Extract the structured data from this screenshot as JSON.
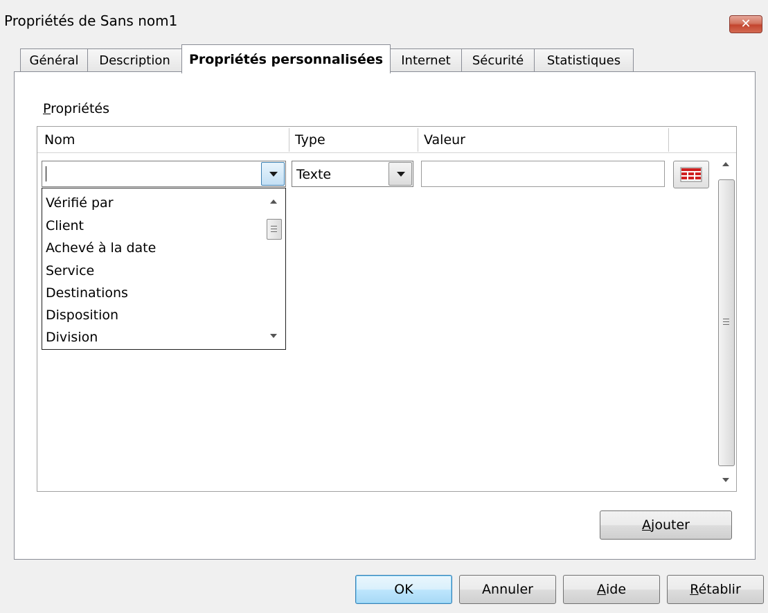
{
  "window": {
    "title": "Propriétés de Sans nom1",
    "close_label": "✕"
  },
  "tabs": [
    {
      "label": "Général"
    },
    {
      "label": "Description"
    },
    {
      "label": "Propriétés personnalisées",
      "active": true
    },
    {
      "label": "Internet"
    },
    {
      "label": "Sécurité"
    },
    {
      "label": "Statistiques"
    }
  ],
  "properties": {
    "label_accel": "P",
    "label_rest": "ropriétés",
    "columns": {
      "name": "Nom",
      "type": "Type",
      "value": "Valeur"
    },
    "row": {
      "name_value": "",
      "type_value": "Texte",
      "value_value": ""
    },
    "name_dropdown": {
      "items": [
        "Vérifié par",
        "Client",
        "Achevé à la date",
        "Service",
        "Destinations",
        "Disposition",
        "Division"
      ]
    }
  },
  "add_button": {
    "accel": "A",
    "rest": "jouter"
  },
  "footer": {
    "ok": "OK",
    "cancel": "Annuler",
    "help_accel": "A",
    "help_rest": "ide",
    "reset_accel": "R",
    "reset_rest": "établir"
  },
  "colors": {
    "close": "#c3452f",
    "ok_focus": "#3c7fb1",
    "table_icon": "#d02020"
  }
}
